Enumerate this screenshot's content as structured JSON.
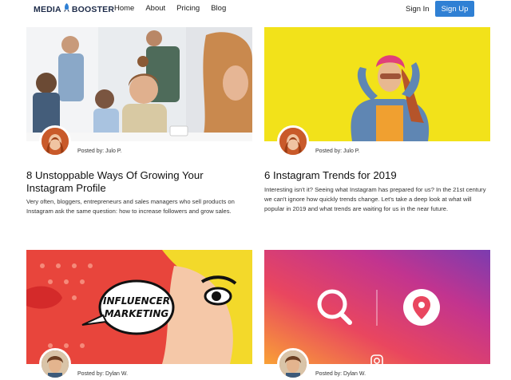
{
  "nav": {
    "logo_left": "MEDIA",
    "logo_right": "BOOSTER",
    "links": [
      "Home",
      "About",
      "Pricing",
      "Blog"
    ],
    "signin": "Sign In",
    "signup": "Sign Up"
  },
  "posts": [
    {
      "posted_by": "Posted by: Julo P.",
      "title": "8 Unstoppable Ways Of Growing Your Instagram Profile",
      "excerpt": "Very often, bloggers, entrepreneurs and sales managers who sell products on Instagram ask the same question: how to increase followers and grow sales."
    },
    {
      "posted_by": "Posted by: Julo P.",
      "title": "6 Instagram Trends for 2019",
      "excerpt": "Interesting isn't it? Seeing what Instagram has prepared for us? In the 21st century we can't ignore how quickly trends change. Let's take a deep look at what will popular in 2019 and what trends are waiting for us in the near future."
    },
    {
      "posted_by": "Posted by: Dylan W.",
      "image_text": "INFLUENCER MARKETING"
    },
    {
      "posted_by": "Posted by: Dylan W."
    }
  ],
  "colors": {
    "accent": "#2f80d4",
    "yellow": "#f2e21a",
    "logo": "#1d2b49"
  }
}
